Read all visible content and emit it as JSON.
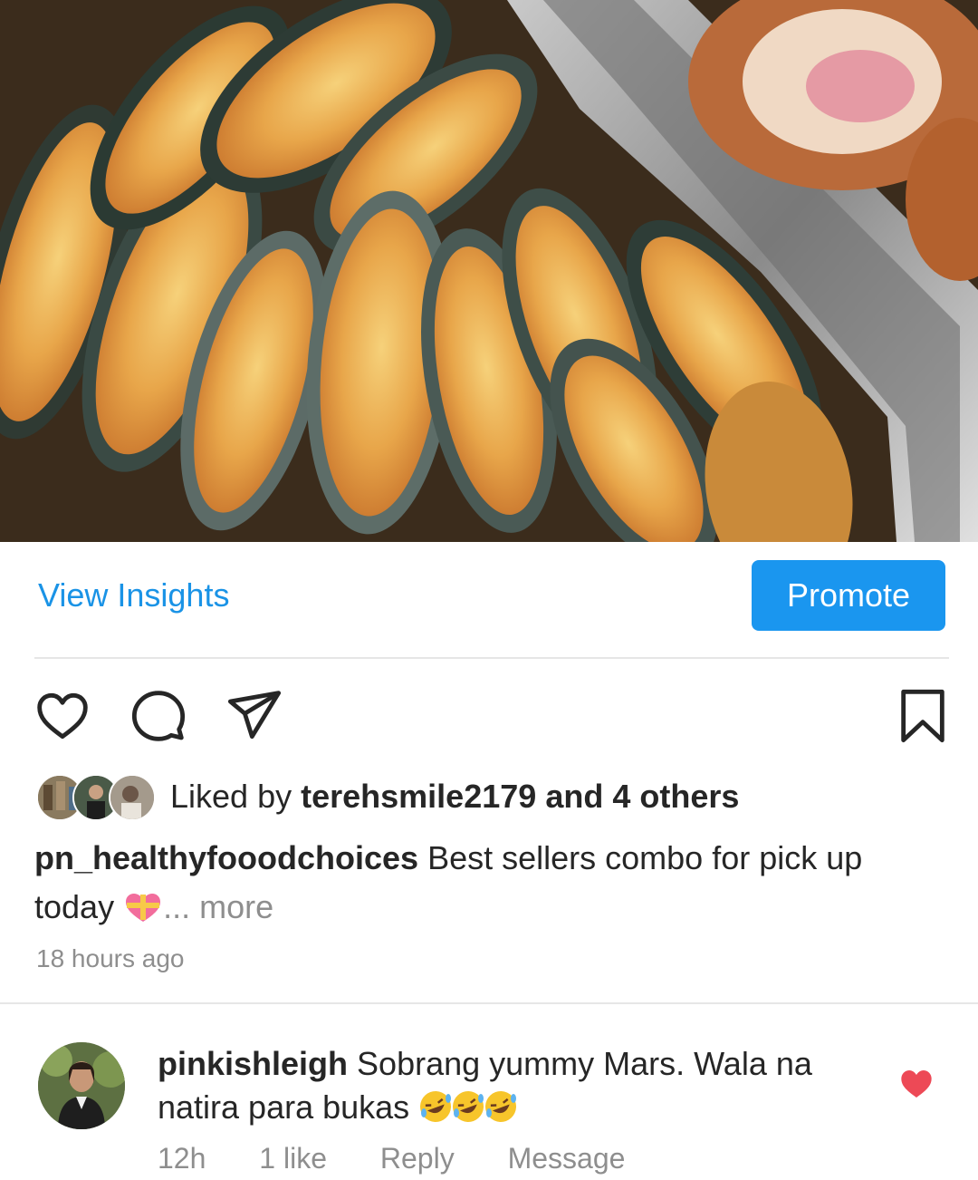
{
  "post": {
    "photo_alt": "Baked cheesy mussels in an aluminium tray",
    "view_insights_label": "View Insights",
    "promote_label": "Promote",
    "liked_by_prefix": "Liked by",
    "liked_by_user": "terehsmile2179",
    "liked_by_and": "and",
    "liked_by_others": "4 others",
    "caption_user": "pn_healthyfooodchoices",
    "caption_text": "Best sellers combo for pick up today",
    "caption_more": "... more",
    "time_ago": "18 hours ago",
    "icons": [
      "heart-icon",
      "comment-icon",
      "share-icon",
      "bookmark-icon"
    ]
  },
  "comment": {
    "user": "pinkishleigh",
    "text": "Sobrang yummy Mars. Wala na natira para bukas",
    "time": "12h",
    "likes": "1 like",
    "reply_label": "Reply",
    "message_label": "Message",
    "liked_color": "#ed4956"
  },
  "colors": {
    "link_blue": "#1a93e6",
    "button_blue": "#1a96ef",
    "muted_text": "#8e8e8e"
  }
}
